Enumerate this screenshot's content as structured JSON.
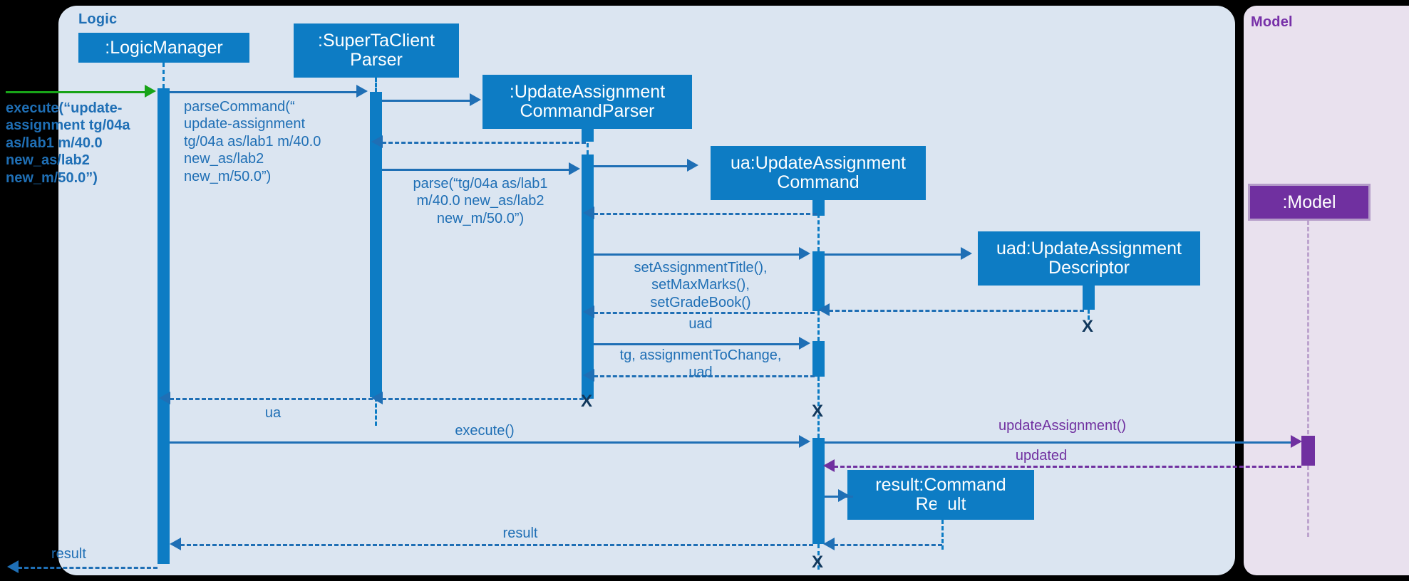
{
  "diagram": {
    "type": "uml-sequence-diagram",
    "colors": {
      "logic_package_bg": "#dbe5f1",
      "model_package_bg": "#e9e1ee",
      "lifeline_blue": "#0d7cc4",
      "message_blue": "#1f6fb5",
      "model_purple": "#7030a0",
      "entry_green": "#18a318",
      "background": "#000000"
    }
  },
  "packages": [
    {
      "name": "Logic",
      "label": "Logic"
    },
    {
      "name": "Model",
      "label": "Model"
    }
  ],
  "participants": [
    {
      "id": "logic_manager",
      "label": ":LogicManager"
    },
    {
      "id": "parser",
      "label": ":SuperTaClient\nParser"
    },
    {
      "id": "command_parser",
      "label": ":UpdateAssignment\nCommandParser"
    },
    {
      "id": "ua_command",
      "label": "ua:UpdateAssignment\nCommand"
    },
    {
      "id": "uad_descriptor",
      "label": "uad:UpdateAssignment\nDescriptor"
    },
    {
      "id": "command_result",
      "label": "result:Command\nResult"
    },
    {
      "id": "model",
      "label": ":Model"
    }
  ],
  "messages": [
    {
      "id": "m1",
      "kind": "entry",
      "label": "execute(“update-\nassignment tg/04a\nas/lab1 m/40.0\nnew_as/lab2\nnew_m/50.0”)"
    },
    {
      "id": "m2",
      "kind": "call",
      "label": "parseCommand(“\nupdate-assignment\ntg/04a as/lab1 m/40.0\nnew_as/lab2\nnew_m/50.0”)"
    },
    {
      "id": "m3",
      "kind": "create",
      "label": ""
    },
    {
      "id": "m4",
      "kind": "return",
      "label": ""
    },
    {
      "id": "m5",
      "kind": "call",
      "label": "parse(“tg/04a as/lab1\nm/40.0 new_as/lab2\nnew_m/50.0”)"
    },
    {
      "id": "m6",
      "kind": "create",
      "label": ""
    },
    {
      "id": "m7",
      "kind": "return",
      "label": ""
    },
    {
      "id": "m8",
      "kind": "call",
      "label": "setAssignmentTitle(),\nsetMaxMarks(),\nsetGradeBook()"
    },
    {
      "id": "m9",
      "kind": "create",
      "label": ""
    },
    {
      "id": "m10",
      "kind": "return",
      "label": ""
    },
    {
      "id": "m11",
      "kind": "return",
      "label": "uad"
    },
    {
      "id": "m12",
      "kind": "call",
      "label": "tg, assignmentToChange,\nuad"
    },
    {
      "id": "m13",
      "kind": "return",
      "label": ""
    },
    {
      "id": "m14",
      "kind": "return",
      "label": "ua"
    },
    {
      "id": "m15",
      "kind": "call",
      "label": "execute()"
    },
    {
      "id": "m16",
      "kind": "call",
      "label": "updateAssignment()"
    },
    {
      "id": "m17",
      "kind": "return",
      "label": "updated"
    },
    {
      "id": "m18",
      "kind": "create",
      "label": ""
    },
    {
      "id": "m19",
      "kind": "return",
      "label": ""
    },
    {
      "id": "m20",
      "kind": "return",
      "label": "result"
    },
    {
      "id": "m21",
      "kind": "return",
      "label": "result"
    }
  ],
  "destroy_markers": [
    {
      "for": "uad_descriptor",
      "glyph": "X"
    },
    {
      "for": "command_parser",
      "glyph": "X"
    },
    {
      "for": "ua_command_mid",
      "glyph": "X"
    },
    {
      "for": "ua_command_end",
      "glyph": "X"
    }
  ]
}
